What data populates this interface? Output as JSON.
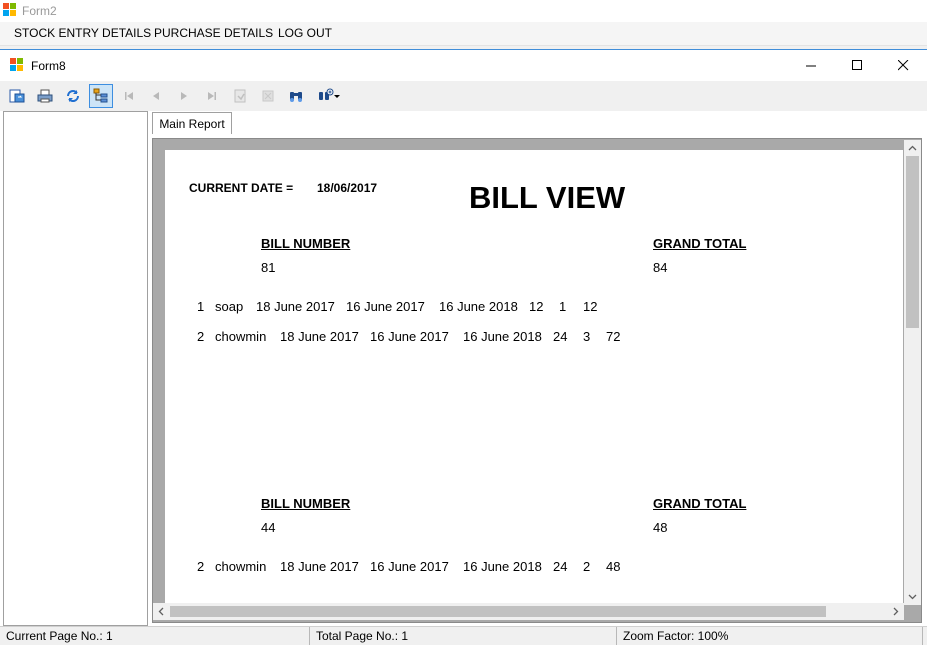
{
  "outer_window": {
    "title": "Form2",
    "icon": "app-icon"
  },
  "menu": {
    "items": [
      {
        "label": "STOCK ENTRY DETAILS"
      },
      {
        "label": "PURCHASE DETAILS"
      },
      {
        "label": "LOG OUT"
      }
    ]
  },
  "child_window": {
    "title": "Form8",
    "icon": "app-icon",
    "controls": {
      "minimize": "—",
      "maximize": "☐",
      "close": "✕"
    }
  },
  "toolbar": {
    "buttons": [
      {
        "icon": "export-icon"
      },
      {
        "icon": "print-icon"
      },
      {
        "icon": "refresh-icon"
      },
      {
        "icon": "toggle-group-tree-icon",
        "active": true
      },
      {
        "icon": "first-page-icon",
        "disabled": true
      },
      {
        "icon": "previous-page-icon",
        "disabled": true
      },
      {
        "icon": "next-page-icon",
        "disabled": true
      },
      {
        "icon": "last-page-icon",
        "disabled": true
      },
      {
        "icon": "goto-page-icon",
        "disabled": true
      },
      {
        "icon": "stop-icon",
        "disabled": true
      },
      {
        "icon": "find-icon"
      },
      {
        "icon": "zoom-icon"
      }
    ]
  },
  "tabs": [
    {
      "label": "Main Report"
    }
  ],
  "report": {
    "current_date_label": "CURRENT DATE =",
    "current_date_value": "18/06/2017",
    "title": "BILL VIEW",
    "groups": [
      {
        "bill_number_label": "BILL NUMBER",
        "grand_total_label": "GRAND TOTAL",
        "bill_number": "81",
        "grand_total": "84",
        "rows": [
          [
            "1",
            "soap",
            "18 June 2017",
            "16 June 2017",
            "16 June 2018",
            "12",
            "1",
            "12"
          ],
          [
            "2",
            "chowmin",
            "18 June 2017",
            "16 June 2017",
            "16 June 2018",
            "24",
            "3",
            "72"
          ]
        ]
      },
      {
        "bill_number_label": "BILL NUMBER",
        "grand_total_label": "GRAND TOTAL",
        "bill_number": "44",
        "grand_total": "48",
        "rows": [
          [
            "2",
            "chowmin",
            "18 June 2017",
            "16 June 2017",
            "16 June 2018",
            "24",
            "2",
            "48"
          ]
        ]
      }
    ]
  },
  "status": {
    "current_page": "Current Page No.: 1",
    "total_page": "Total Page No.: 1",
    "zoom": "Zoom Factor: 100%"
  }
}
